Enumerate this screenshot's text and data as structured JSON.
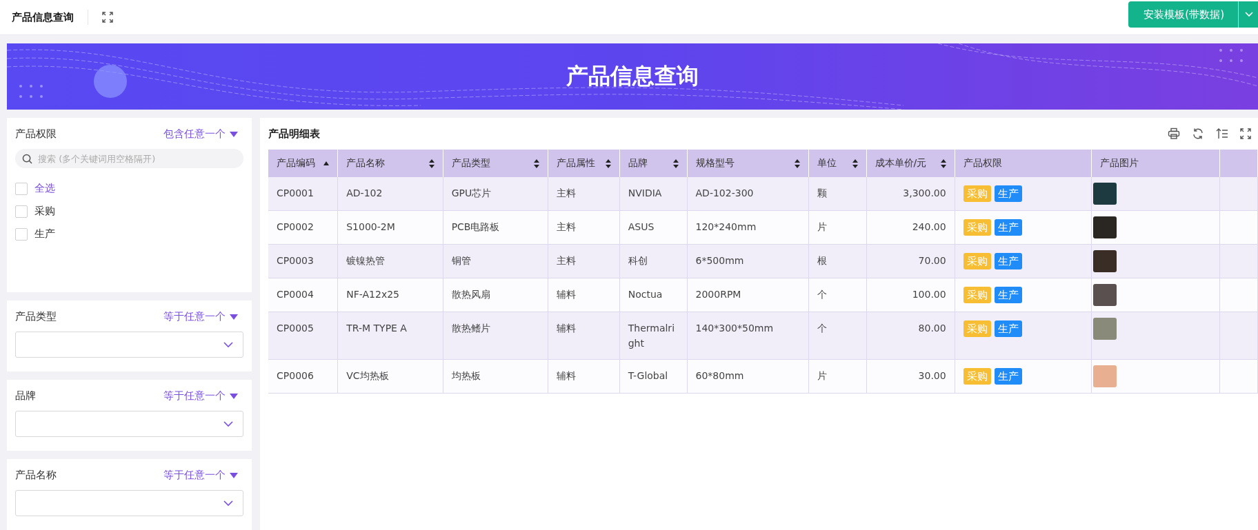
{
  "header": {
    "title": "产品信息查询",
    "install_button": "安装模板(带数据)"
  },
  "banner": {
    "title": "产品信息查询"
  },
  "filters": [
    {
      "kind": "checklist",
      "label": "产品权限",
      "operator": "包含任意一个",
      "search_placeholder": "搜索 (多个关键词用空格隔开)",
      "options": [
        {
          "label": "全选",
          "kind": "all",
          "checked": false
        },
        {
          "label": "采购",
          "kind": "option",
          "checked": false
        },
        {
          "label": "生产",
          "kind": "option",
          "checked": false
        }
      ]
    },
    {
      "kind": "select",
      "label": "产品类型",
      "operator": "等于任意一个"
    },
    {
      "kind": "select",
      "label": "品牌",
      "operator": "等于任意一个"
    },
    {
      "kind": "select",
      "label": "产品名称",
      "operator": "等于任意一个"
    }
  ],
  "table": {
    "title": "产品明细表",
    "columns": [
      {
        "label": "产品编码",
        "kind": "text",
        "sortable": true,
        "sorted": true
      },
      {
        "label": "产品名称",
        "kind": "text",
        "sortable": true,
        "sorted": false
      },
      {
        "label": "产品类型",
        "kind": "text",
        "sortable": true,
        "sorted": false
      },
      {
        "label": "产品属性",
        "kind": "text",
        "sortable": true,
        "sorted": false
      },
      {
        "label": "品牌",
        "kind": "text",
        "sortable": true,
        "sorted": false
      },
      {
        "label": "规格型号",
        "kind": "text",
        "sortable": true,
        "sorted": false
      },
      {
        "label": "单位",
        "kind": "text",
        "sortable": true,
        "sorted": false
      },
      {
        "label": "成本单价/元",
        "kind": "number",
        "sortable": true,
        "sorted": false
      },
      {
        "label": "产品权限",
        "kind": "tags",
        "sortable": false,
        "sorted": false
      },
      {
        "label": "产品图片",
        "kind": "image",
        "sortable": false,
        "sorted": false
      }
    ],
    "rows": [
      {
        "cells": [
          "CP0001",
          "AD-102",
          "GPU芯片",
          "主料",
          "NVIDIA",
          "AD-102-300",
          "颗",
          "3,300.00"
        ],
        "tags": [
          {
            "label": "采购",
            "color": "#f7bd33"
          },
          {
            "label": "生产",
            "color": "#1f8cf7"
          }
        ]
      },
      {
        "cells": [
          "CP0002",
          "S1000-2M",
          "PCB电路板",
          "主料",
          "ASUS",
          "120*240mm",
          "片",
          "240.00"
        ],
        "tags": [
          {
            "label": "采购",
            "color": "#f7bd33"
          },
          {
            "label": "生产",
            "color": "#1f8cf7"
          }
        ]
      },
      {
        "cells": [
          "CP0003",
          "镀镍热管",
          "铜管",
          "主料",
          "科创",
          "6*500mm",
          "根",
          "70.00"
        ],
        "tags": [
          {
            "label": "采购",
            "color": "#f7bd33"
          },
          {
            "label": "生产",
            "color": "#1f8cf7"
          }
        ]
      },
      {
        "cells": [
          "CP0004",
          "NF-A12x25",
          "散热风扇",
          "辅料",
          "Noctua",
          "2000RPM",
          "个",
          "100.00"
        ],
        "tags": [
          {
            "label": "采购",
            "color": "#f7bd33"
          },
          {
            "label": "生产",
            "color": "#1f8cf7"
          }
        ]
      },
      {
        "cells": [
          "CP0005",
          "TR-M TYPE A",
          "散热鳍片",
          "辅料",
          "Thermalright",
          "140*300*50mm",
          "个",
          "80.00"
        ],
        "tags": [
          {
            "label": "采购",
            "color": "#f7bd33"
          },
          {
            "label": "生产",
            "color": "#1f8cf7"
          }
        ]
      },
      {
        "cells": [
          "CP0006",
          "VC均热板",
          "均热板",
          "辅料",
          "T-Global",
          "60*80mm",
          "片",
          "30.00"
        ],
        "tags": [
          {
            "label": "采购",
            "color": "#f7bd33"
          },
          {
            "label": "生产",
            "color": "#1f8cf7"
          }
        ]
      }
    ]
  }
}
